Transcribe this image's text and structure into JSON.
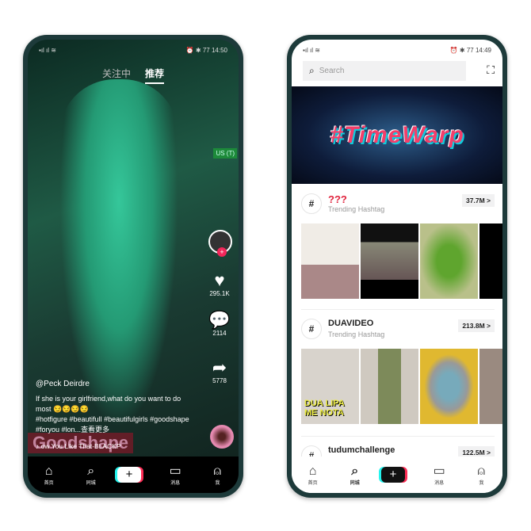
{
  "left_phone": {
    "status": {
      "time": "14:50",
      "battery": "77",
      "icons": "alarm bluetooth"
    },
    "tabs": [
      "关注中",
      "推荐"
    ],
    "region_badge": "US (T)",
    "actions": {
      "likes": "295.1K",
      "comments": "2114",
      "shares": "5778"
    },
    "caption": {
      "username": "@Peck Deirdre",
      "text": "If she is your girlfriend,what do you want to do most 😏😏😏😏",
      "hashtags": "#hotfigure #beautifull #beautifulgirls #goodshape #foryou #lon...",
      "more": "查看更多",
      "music": "♪ ow You Like That-BLACKP"
    },
    "watermark": "Goodshape",
    "nav": [
      {
        "label": "首页",
        "icon": "home"
      },
      {
        "label": "同城",
        "icon": "search"
      },
      {
        "label": "",
        "icon": "plus"
      },
      {
        "label": "消息",
        "icon": "inbox"
      },
      {
        "label": "我",
        "icon": "profile"
      }
    ]
  },
  "right_phone": {
    "status": {
      "time": "14:49",
      "battery": "77"
    },
    "search": {
      "placeholder": "Search"
    },
    "banner": "#TimeWarp",
    "hashtags": [
      {
        "name": "???",
        "subtitle": "Trending Hashtag",
        "count": "37.7M >",
        "thumbs": [
          "#f0ece6",
          "#222",
          "#8fb05a",
          "#000"
        ]
      },
      {
        "name": "DUAVIDEO",
        "subtitle": "Trending Hashtag",
        "count": "213.8M >",
        "thumbs": [
          "#d8d3cc",
          "#cfc9c0",
          "#e0b830",
          "#9a8a80"
        ]
      },
      {
        "name": "tudumchallenge",
        "subtitle": "",
        "count": "122.5M >"
      }
    ],
    "thumb_text": {
      "dua": "DUA LIPA ME NOTA"
    },
    "nav": [
      {
        "label": "首页",
        "icon": "home"
      },
      {
        "label": "同城",
        "icon": "search"
      },
      {
        "label": "",
        "icon": "plus"
      },
      {
        "label": "消息",
        "icon": "inbox"
      },
      {
        "label": "我",
        "icon": "profile"
      }
    ]
  }
}
